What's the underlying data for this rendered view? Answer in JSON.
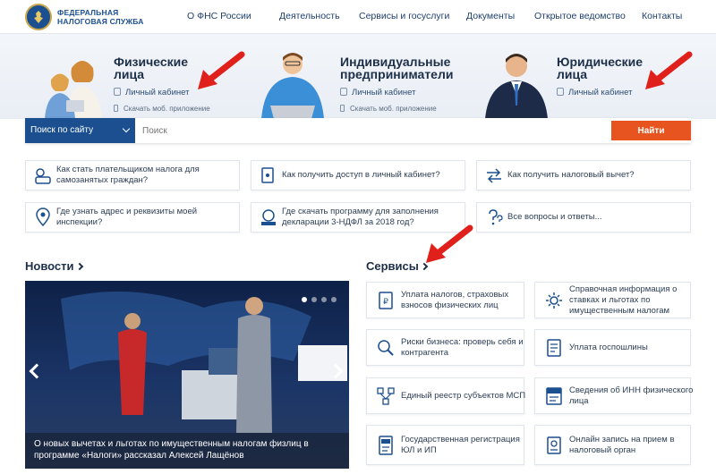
{
  "header": {
    "logo_text": "ФЕДЕРАЛЬНАЯ НАЛОГОВАЯ СЛУЖБА",
    "nav": [
      "О ФНС России",
      "Деятельность",
      "Сервисы и госуслуги",
      "Документы",
      "Открытое ведомство",
      "Контакты"
    ]
  },
  "hero": {
    "individuals": {
      "title": "Физические лица",
      "cabinet": "Личный кабинет",
      "app": "Скачать моб. приложение"
    },
    "entrepreneurs": {
      "title": "Индивидуальные предприниматели",
      "cabinet": "Личный кабинет",
      "app": "Скачать моб. приложение"
    },
    "legal": {
      "title": "Юридические лица",
      "cabinet": "Личный кабинет"
    }
  },
  "search": {
    "scope": "Поиск по сайту",
    "placeholder": "Поиск",
    "button": "Найти"
  },
  "quick": [
    "Как стать плательщиком налога для самозанятых граждан?",
    "Как получить доступ в личный кабинет?",
    "Как получить налоговый вычет?",
    "Где узнать адрес и реквизиты моей инспекции?",
    "Где скачать программу для заполнения декларации 3-НДФЛ за 2018 год?",
    "Все вопросы и ответы..."
  ],
  "news": {
    "title": "Новости",
    "caption": "О новых вычетах и льготах по имущественным налогам физлиц в программе «Налоги» рассказал Алексей Лащёнов"
  },
  "services": {
    "title": "Сервисы",
    "items": [
      "Уплата налогов, страховых взносов физических лиц",
      "Справочная информация о ставках и льготах по имущественным налогам",
      "Риски бизнеса: проверь себя и контрагента",
      "Уплата госпошлины",
      "Единый реестр субъектов МСП",
      "Сведения об ИНН физического лица",
      "Государственная регистрация ЮЛ и ИП",
      "Онлайн запись на прием в налоговый орган"
    ]
  },
  "colors": {
    "brand": "#1b4f8f",
    "accent": "#e8541f",
    "arrow": "#e0201b"
  }
}
